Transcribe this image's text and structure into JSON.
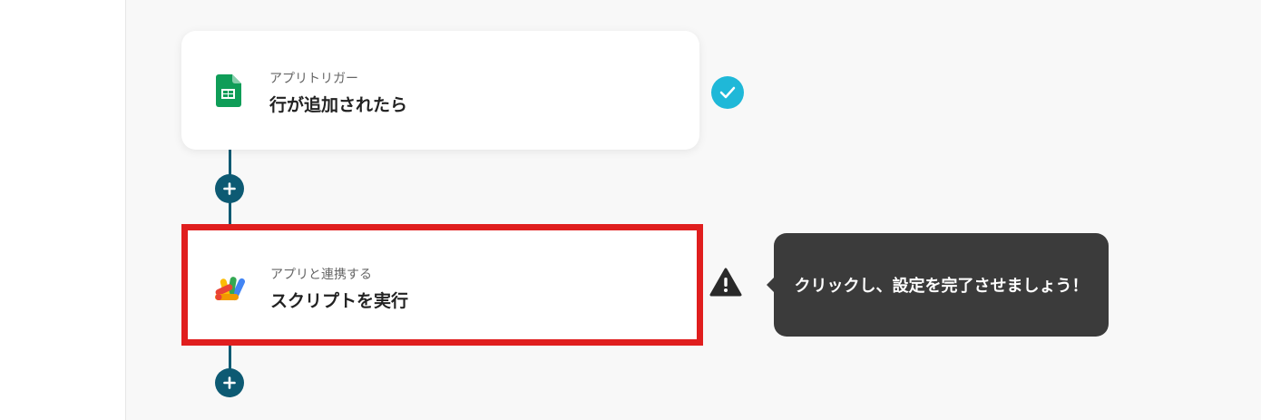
{
  "flow": {
    "trigger": {
      "subtitle": "アプリトリガー",
      "title": "行が追加されたら",
      "icon": "google-sheets-icon",
      "status_icon": "check-icon"
    },
    "action": {
      "subtitle": "アプリと連携する",
      "title": "スクリプトを実行",
      "icon": "google-apps-script-icon",
      "status_icon": "warning-icon"
    },
    "tooltip": {
      "text": "クリックし、設定を完了させましょう！"
    }
  },
  "colors": {
    "connector": "#0d5a73",
    "highlight_border": "#e01e1e",
    "check_badge": "#1fb8d8",
    "tooltip_bg": "#3b3b3b"
  }
}
